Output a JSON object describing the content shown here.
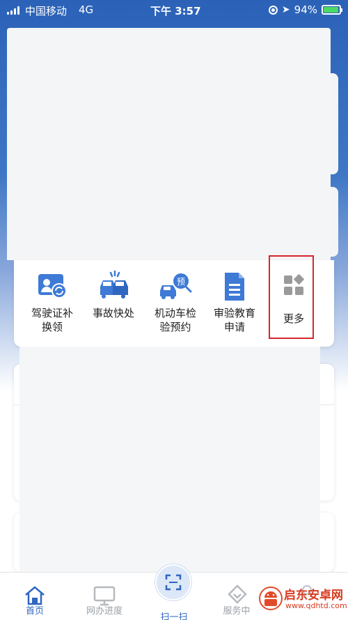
{
  "status_bar": {
    "carrier": "中国移动",
    "network": "4G",
    "time": "下午 3:57",
    "battery": "94%",
    "battery_level": 0.94
  },
  "quick_services": [
    {
      "label": "驾驶证补换领",
      "icon": "license-replace-icon"
    },
    {
      "label": "事故快处",
      "icon": "accident-cars-icon"
    },
    {
      "label": "机动车检验预约",
      "icon": "vehicle-inspection-booking-icon"
    },
    {
      "label": "审验教育申请",
      "icon": "document-icon"
    },
    {
      "label": "更多",
      "icon": "more-grid-icon"
    }
  ],
  "quick_labels": {
    "l0a": "驾驶证补",
    "l0b": "换领",
    "l1a": "事故快处",
    "l2a": "机动车检",
    "l2b": "验预约",
    "l3a": "审验教育",
    "l3b": "申请",
    "l4a": "更多"
  },
  "tab_bar": {
    "home": "首页",
    "progress": "网办进度",
    "scan": "扫一扫",
    "service": "服务中",
    "me": ""
  },
  "watermark": {
    "name": "启东安卓网",
    "url": "www.qdhtd.com"
  },
  "colors": {
    "accent": "#2f66c0",
    "highlight": "#d6262b",
    "icon_blue": "#3e7ad6"
  }
}
